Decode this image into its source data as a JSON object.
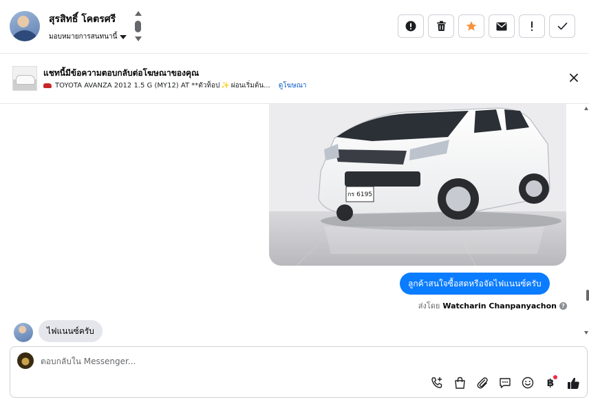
{
  "header": {
    "contact_name": "สุรสิทธิ์ โคตรศรี",
    "assign_label": "มอบหมายการสนทนานี้",
    "action_buttons": [
      {
        "name": "report-button",
        "icon": "exclamation-circle-icon"
      },
      {
        "name": "delete-button",
        "icon": "trash-icon"
      },
      {
        "name": "star-button",
        "icon": "star-icon"
      },
      {
        "name": "mark-unread-button",
        "icon": "envelope-icon"
      },
      {
        "name": "spam-button",
        "icon": "exclamation-icon"
      },
      {
        "name": "mark-done-button",
        "icon": "checkmark-icon"
      }
    ]
  },
  "ad_banner": {
    "title": "แชทนี้มีข้อความตอบกลับต่อโฆษณาของคุณ",
    "ad_text": "TOYOTA AVANZA 2012 1.5 G (MY12) AT **ตัวท็อป",
    "ad_text_tail": "ผ่อนเริ่มต้น...",
    "view_ad_link": "ดูโฆษณา"
  },
  "conversation": {
    "outgoing_image_alt": "white Toyota Avanza",
    "license_plate": "กร 6195",
    "outgoing_message": "ลูกค้าสนใจซื้อสดหรือจัดไฟแนนซ์ครับ",
    "sent_by_label": "ส่งโดย",
    "sent_by_name": "Watcharin Chanpanyachon",
    "incoming_message": "ไฟแนนซ์ครับ"
  },
  "composer": {
    "placeholder": "ตอบกลับใน Messenger...",
    "tools": [
      "phone-add-icon",
      "shopping-bag-icon",
      "paperclip-icon",
      "chat-bubble-icon",
      "emoji-icon",
      "baht-icon",
      "like-thumb-icon"
    ],
    "baht_symbol": "฿"
  },
  "colors": {
    "accent_blue": "#0a7cff",
    "star_orange": "#f7923b",
    "link_blue": "#0a5bc4",
    "notification_red": "#f02849"
  }
}
